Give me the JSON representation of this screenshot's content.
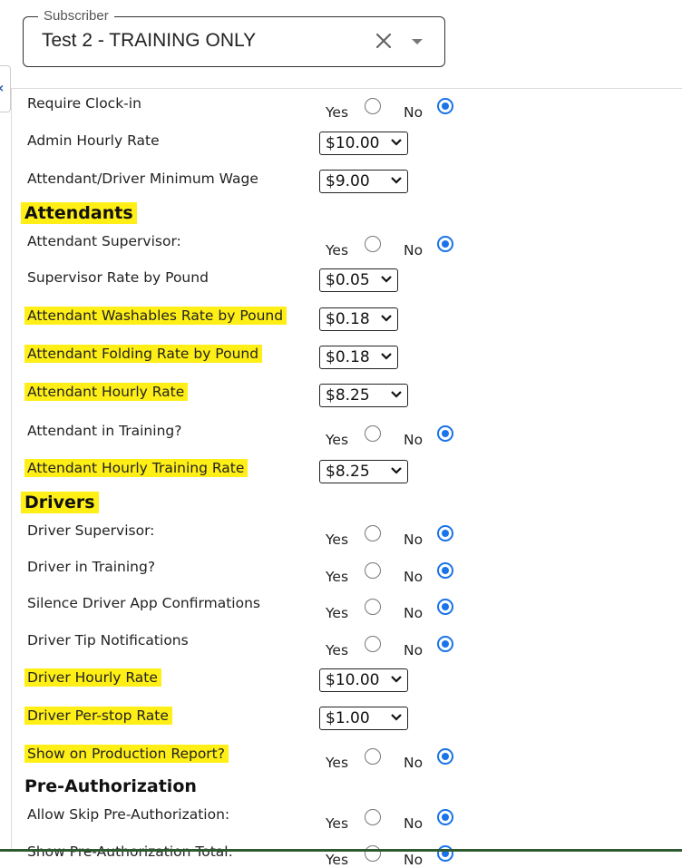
{
  "subscriber": {
    "legend": "Subscriber",
    "value": "Test 2 - TRAINING ONLY"
  },
  "yes_label": "Yes",
  "no_label": "No",
  "rows": [
    {
      "label": "Require Clock-in",
      "type": "yesno",
      "selected": "no"
    },
    {
      "label": "Admin Hourly Rate",
      "type": "select",
      "value": "$10.00"
    },
    {
      "label": "Attendant/Driver Minimum Wage",
      "type": "select",
      "value": "$9.00"
    },
    {
      "label": "Attendants",
      "type": "section"
    },
    {
      "label": "Attendant Supervisor:",
      "type": "yesno",
      "selected": "no"
    },
    {
      "label": "Supervisor Rate by Pound",
      "type": "select",
      "value": "$0.05"
    },
    {
      "label": "Attendant Washables Rate by Pound",
      "type": "select",
      "value": "$0.18"
    },
    {
      "label": "Attendant Folding Rate by Pound",
      "type": "select",
      "value": "$0.18"
    },
    {
      "label": "Attendant Hourly Rate",
      "type": "select",
      "value": "$8.25"
    },
    {
      "label": "Attendant in Training?",
      "type": "yesno",
      "selected": "no"
    },
    {
      "label": "Attendant Hourly Training Rate",
      "type": "select",
      "value": "$8.25"
    },
    {
      "label": "Drivers",
      "type": "section"
    },
    {
      "label": "Driver Supervisor:",
      "type": "yesno",
      "selected": "no"
    },
    {
      "label": "Driver in Training?",
      "type": "yesno",
      "selected": "no"
    },
    {
      "label": "Silence Driver App Confirmations",
      "type": "yesno",
      "selected": "no"
    },
    {
      "label": "Driver Tip Notifications",
      "type": "yesno",
      "selected": "no"
    },
    {
      "label": "Driver Hourly Rate",
      "type": "select",
      "value": "$10.00"
    },
    {
      "label": "Driver Per-stop Rate",
      "type": "select",
      "value": "$1.00"
    },
    {
      "label": "Show on Production Report?",
      "type": "yesno",
      "selected": "no"
    },
    {
      "label": "Pre-Authorization",
      "type": "section"
    },
    {
      "label": "Allow Skip Pre-Authorization:",
      "type": "yesno",
      "selected": "no"
    },
    {
      "label": "Show Pre-Authorization Total:",
      "type": "yesno",
      "selected": "no"
    }
  ],
  "highlight_color": "#ffef16",
  "accent_color": "#1a73e8"
}
